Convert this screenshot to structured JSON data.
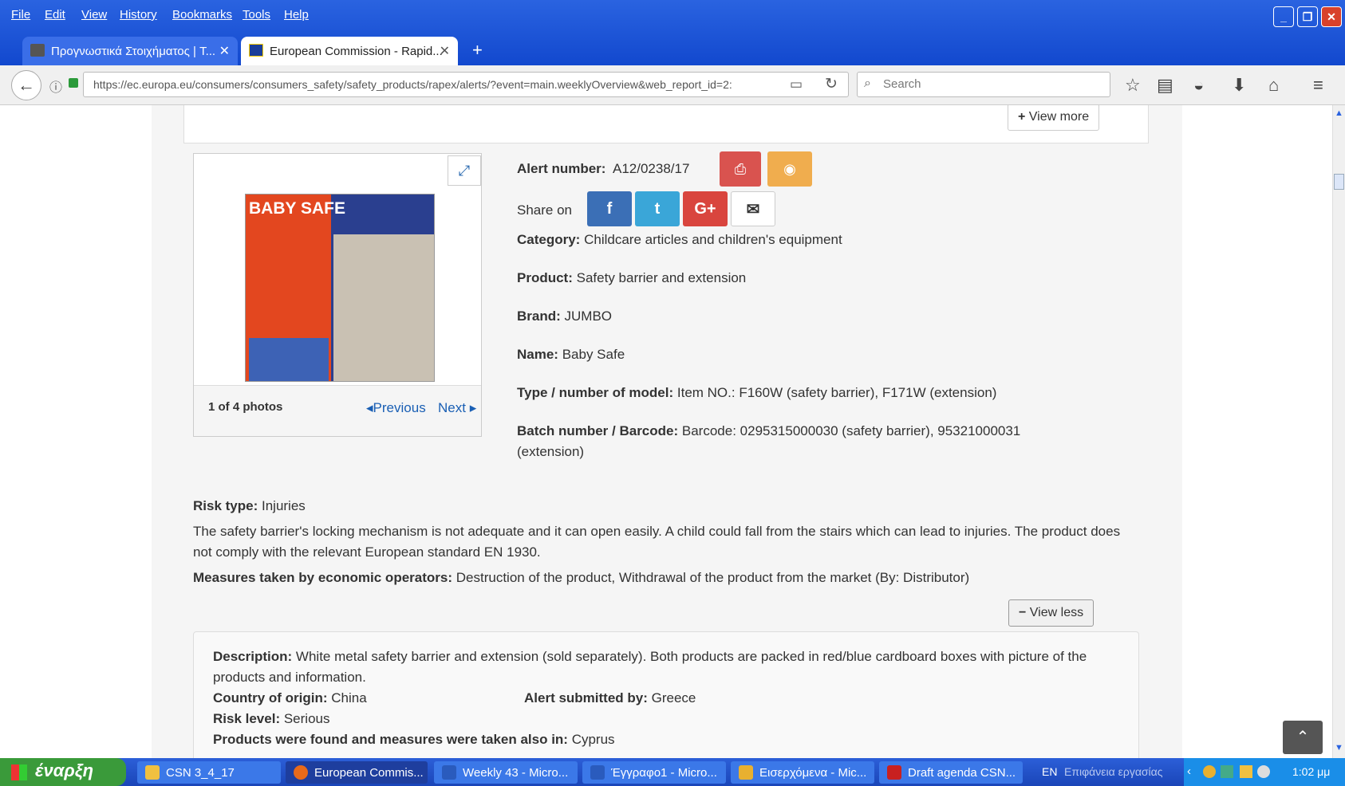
{
  "browser": {
    "menu": [
      "File",
      "Edit",
      "View",
      "History",
      "Bookmarks",
      "Tools",
      "Help"
    ],
    "tabs": [
      {
        "label": "Προγνωστικά Στοιχήματος | T..."
      },
      {
        "label": "European Commission - Rapid..."
      }
    ],
    "new_tab": "+",
    "url": "https://ec.europa.eu/consumers/consumers_safety/safety_products/rapex/alerts/?event=main.weeklyOverview&web_report_id=2:",
    "search_placeholder": "Search",
    "close_tab": "✕"
  },
  "page": {
    "view_more": "View more",
    "photo": {
      "brand_text": "BABY SAFE",
      "caption": "1 of 4 photos",
      "prev": "Previous",
      "next": "Next"
    },
    "alert": {
      "label": "Alert number:",
      "value": "A12/0238/17"
    },
    "share_label": "Share on",
    "fields": [
      {
        "label": "Category:",
        "value": "Childcare articles and children's equipment"
      },
      {
        "label": "Product:",
        "value": "Safety barrier and extension"
      },
      {
        "label": "Brand:",
        "value": "JUMBO"
      },
      {
        "label": "Name:",
        "value": "Baby Safe"
      },
      {
        "label": "Type / number of model:",
        "value": "Item NO.: F160W (safety barrier), F171W (extension)"
      },
      {
        "label": "Batch number / Barcode:",
        "value": "Barcode: 0295315000030 (safety barrier), 95321000031 (extension)"
      }
    ],
    "risk_type": {
      "label": "Risk type:",
      "value": "Injuries"
    },
    "risk_text": "The safety barrier's locking mechanism is not adequate and it can open easily. A child could fall from the stairs which can lead to injuries.  The product does not comply with the relevant European standard EN 1930.",
    "measures": {
      "label": "Measures taken by economic operators:",
      "value": "Destruction of the product, Withdrawal of the product from the market (By: Distributor)"
    },
    "view_less": "View less",
    "details": {
      "description": {
        "label": "Description:",
        "value": "White metal safety barrier and extension (sold separately). Both products are packed in red/blue cardboard boxes with picture of the products and information."
      },
      "origin": {
        "label": "Country of origin:",
        "value": "China"
      },
      "submitted": {
        "label": "Alert submitted by:",
        "value": "Greece"
      },
      "risk_level": {
        "label": "Risk level:",
        "value": "Serious"
      },
      "found_in": {
        "label": "Products were found and measures were taken also in:",
        "value": "Cyprus"
      }
    }
  },
  "taskbar": {
    "start": "έναρξη",
    "items": [
      "CSN 3_4_17",
      "European Commis...",
      "Weekly 43 - Micro...",
      "Έγγραφο1 - Micro...",
      "Εισερχόμενα - Mic...",
      "Draft agenda CSN..."
    ],
    "lang": "EN",
    "desktop": "Επιφάνεια εργασίας",
    "time": "1:02 μμ"
  }
}
